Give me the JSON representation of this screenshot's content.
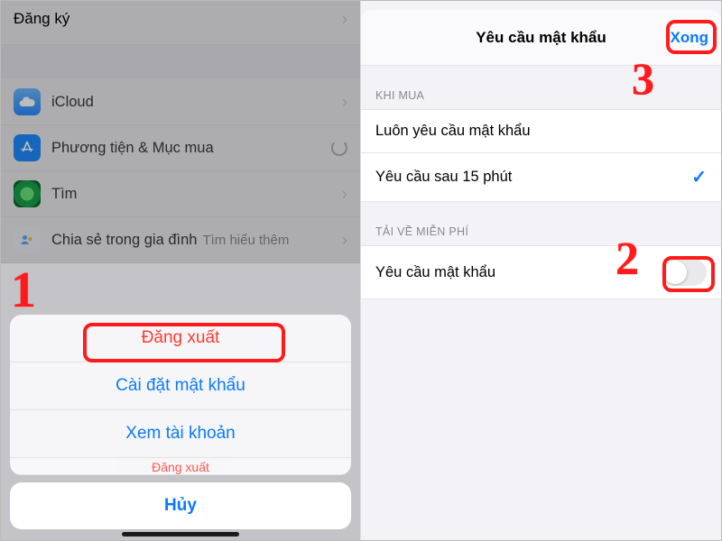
{
  "left": {
    "header": "Đăng ký",
    "rows": {
      "icloud": "iCloud",
      "media": "Phương tiện & Mục mua",
      "find": "Tìm",
      "family": "Chia sẻ trong gia đình",
      "family_hint": "Tìm hiểu thêm"
    },
    "sheet": {
      "peek": "Đăng xuất",
      "signout": "Đăng xuất",
      "password": "Cài đặt mật khẩu",
      "account": "Xem tài khoản",
      "cancel": "Hủy"
    }
  },
  "right": {
    "title": "Yêu cầu mật khẩu",
    "done": "Xong",
    "section_buy": "KHI MUA",
    "opt_always": "Luôn yêu cầu mật khẩu",
    "opt_15": "Yêu cầu sau 15 phút",
    "section_free": "TẢI VỀ MIỄN PHÍ",
    "require_pw": "Yêu cầu mật khẩu"
  },
  "ann": {
    "one": "1",
    "two": "2",
    "three": "3"
  }
}
